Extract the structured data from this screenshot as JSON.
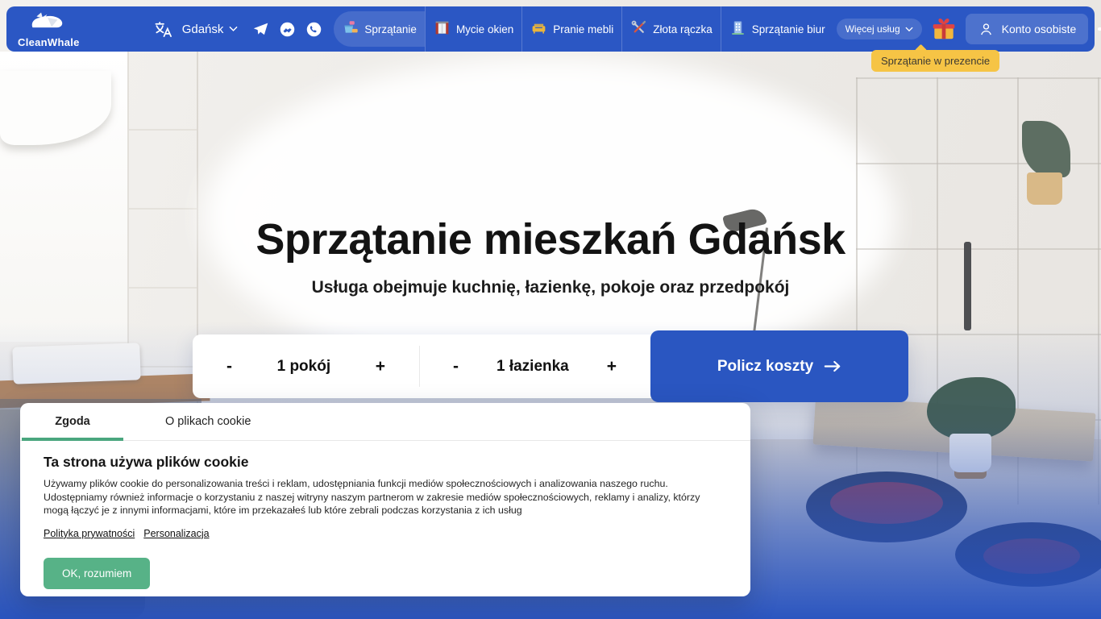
{
  "header": {
    "logo_text": "CleanWhale",
    "city": "Gdańsk",
    "services": [
      {
        "label": "Sprzątanie",
        "icon": "cleaning-bucket-icon",
        "active": true
      },
      {
        "label": "Mycie okien",
        "icon": "window-icon",
        "active": false
      },
      {
        "label": "Pranie mebli",
        "icon": "sofa-icon",
        "active": false
      },
      {
        "label": "Złota rączka",
        "icon": "tools-icon",
        "active": false
      },
      {
        "label": "Sprzątanie biur",
        "icon": "office-building-icon",
        "active": false
      }
    ],
    "social_icons": [
      "telegram-icon",
      "messenger-icon",
      "whatsapp-icon"
    ],
    "more_services_label": "Więcej usług",
    "account_label": "Konto osobiste",
    "gift_tooltip": "Sprzątanie w prezencie"
  },
  "hero": {
    "title": "Sprzątanie mieszkań Gdańsk",
    "subtitle": "Usługa obejmuje kuchnię, łazienkę, pokoje oraz przedpokój"
  },
  "calculator": {
    "minus": "-",
    "plus": "+",
    "rooms_value": "1 pokój",
    "bathrooms_value": "1 łazienka",
    "submit_label": "Policz koszty"
  },
  "cookie_banner": {
    "tab_consent": "Zgoda",
    "tab_about": "O plikach cookie",
    "heading": "Ta strona używa plików cookie",
    "body": "Używamy plików cookie do personalizowania treści i reklam, udostępniania funkcji mediów społecznościowych i analizowania naszego ruchu. Udostępniamy również informacje o korzystaniu z naszej witryny naszym partnerom w zakresie mediów społecznościowych, reklamy i analizy, którzy mogą łączyć je z innymi informacjami, które im przekazałeś lub które zebrali podczas korzystania z ich usług",
    "privacy_link": "Polityka prywatności",
    "personalization_link": "Personalizacja",
    "accept_label": "OK, rozumiem"
  },
  "colors": {
    "navbar_blue": "#2b57c4",
    "button_blue": "#2a56c1",
    "tooltip_yellow": "#f6c445",
    "accept_green": "#57b287",
    "tab_underline_green": "#4aa67e"
  }
}
